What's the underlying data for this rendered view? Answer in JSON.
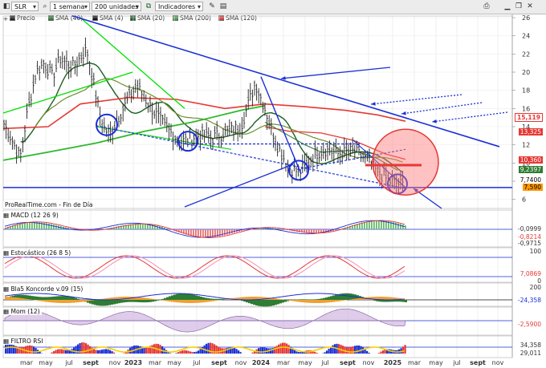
{
  "toolbar": {
    "symbol": "SLR",
    "period": "1 semana",
    "units": "200 unidades",
    "indicators": "Indicadores"
  },
  "legend": [
    {
      "label": "Precio",
      "color": "#222222"
    },
    {
      "label": "SMA (40)",
      "color": "#2e7d32"
    },
    {
      "label": "SMA (4)",
      "color": "#111111"
    },
    {
      "label": "SMA (20)",
      "color": "#1b5e20"
    },
    {
      "label": "SMA (200)",
      "color": "#43a047"
    },
    {
      "label": "SMA (120)",
      "color": "#e53935"
    }
  ],
  "watermark": "ProRealTime.com - Fin de Día",
  "panels": {
    "macd": {
      "label": "MACD (12 26 9)",
      "values": [
        "-0,0999",
        "-0,8214",
        "-0,9715"
      ]
    },
    "stoch": {
      "label": "Estocástico (26 8 5)",
      "values": [
        "100",
        "7,0869",
        "0"
      ]
    },
    "blai": {
      "label": "Bla5 Koncorde v.09 (15)",
      "values": [
        "200",
        "-24,358"
      ]
    },
    "mom": {
      "label": "Mom (12)",
      "values": [
        "-2,5900"
      ]
    },
    "rsi": {
      "label": "FILTRO RSI",
      "values": [
        "34,358",
        "29,011"
      ]
    }
  },
  "price_axis": [
    "26",
    "24",
    "22",
    "20",
    "18",
    "16",
    "14",
    "12",
    "10",
    "8",
    "6"
  ],
  "price_labels": [
    {
      "text": "15,119",
      "color": "#e53935",
      "bg": "#ffffff"
    },
    {
      "text": "13,325",
      "color": "#ffffff",
      "bg": "#e53935"
    },
    {
      "text": "10,360",
      "color": "#ffffff",
      "bg": "#e53935"
    },
    {
      "text": "9,2397",
      "color": "#ffffff",
      "bg": "#2e7d32"
    },
    {
      "text": "7,7400",
      "color": "#000000",
      "bg": "#ffffff"
    },
    {
      "text": "7,590",
      "color": "#000000",
      "bg": "#ff9800"
    }
  ],
  "time_axis": [
    "mar",
    "may",
    "jul",
    "sept",
    "nov",
    "2023",
    "mar",
    "may",
    "jul",
    "sept",
    "nov",
    "2024",
    "mar",
    "may",
    "jul",
    "sept",
    "nov",
    "2025",
    "mar",
    "may",
    "jul",
    "sept",
    "nov"
  ],
  "colors": {
    "blue_line": "#1a2fd6",
    "red_sma": "#e53935",
    "green_sma": "#2e7d32",
    "light_green": "#00e000"
  }
}
